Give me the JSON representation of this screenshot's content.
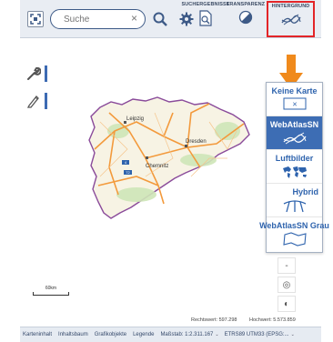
{
  "toolbar": {
    "search_placeholder": "Suche",
    "results_label": "SUCHERGEBNISSE",
    "transparency_label": "TRANSPARENZ",
    "background_label": "HINTERGRUND"
  },
  "background_panel": {
    "items": [
      {
        "label": "Keine Karte",
        "icon": "close-icon"
      },
      {
        "label": "WebAtlasSN",
        "icon": "webatlas-thumb"
      },
      {
        "label": "Luftbilder",
        "icon": "world-map-icon"
      },
      {
        "label": "Hybrid",
        "icon": "hybrid-icon"
      },
      {
        "label": "WebAtlasSN Grau",
        "icon": "map-outline-icon"
      }
    ],
    "active_index": 1
  },
  "map": {
    "cities": [
      "Leipzig",
      "Dresden",
      "Chemnitz"
    ],
    "road_badges": [
      "4",
      "72"
    ],
    "scale_label": "60km"
  },
  "zoom_controls": [
    "-",
    "◎",
    "◐"
  ],
  "coordinates": {
    "rechtswert": "Rechtswert: 597.298",
    "hochwert": "Hochwert: 5.573.859"
  },
  "statusbar": {
    "items": [
      "Karteninhalt",
      "Inhaltsbaum",
      "Grafikobjekte",
      "Legende"
    ],
    "scale_select": "Maßstab: 1:2.311.167",
    "crs_select": "ETRS89 UTM33 (EPSG:..."
  },
  "colors": {
    "accent": "#3d6db4",
    "highlight": "#e32528",
    "arrow": "#f08a1c",
    "roads": "#f39a3c"
  }
}
